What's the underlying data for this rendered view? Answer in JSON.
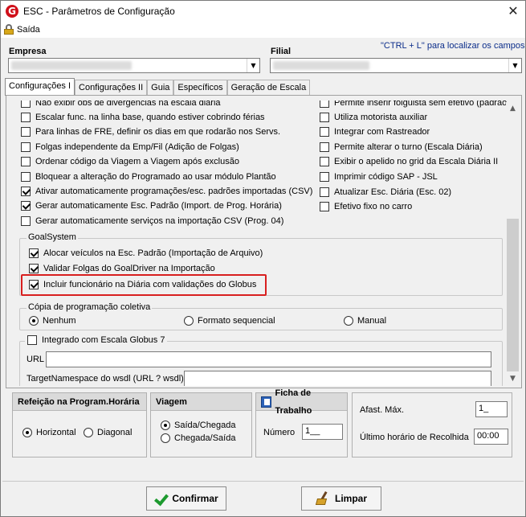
{
  "window": {
    "title": "ESC - Parâmetros de Configuração",
    "close_glyph": "✕",
    "app_icon_letter": "G"
  },
  "menu": {
    "sair": "Saída"
  },
  "empresa": {
    "label": "Empresa"
  },
  "filial": {
    "label": "Filial"
  },
  "hint": "\"CTRL + L\" para localizar os campos",
  "tabs": [
    {
      "label": "Configurações I",
      "active": true
    },
    {
      "label": "Configurações II"
    },
    {
      "label": "Guia"
    },
    {
      "label": "Específicos"
    },
    {
      "label": "Geração de Escala"
    }
  ],
  "left_checks": [
    {
      "label": "Não exibir obs de divergências na escala diária",
      "checked": false
    },
    {
      "label": "Escalar func. na linha base, quando estiver cobrindo férias",
      "checked": false
    },
    {
      "label": "Para linhas de FRE, definir os dias em que rodarão nos Servs.",
      "checked": false
    },
    {
      "label": "Folgas independente da Emp/Fil (Adição de Folgas)",
      "checked": false
    },
    {
      "label": "Ordenar código da Viagem a Viagem após exclusão",
      "checked": false
    },
    {
      "label": "Bloquear a alteração do Programado ao usar módulo Plantão",
      "checked": false
    },
    {
      "label": "Ativar automaticamente programações/esc. padrões importadas (CSV)",
      "checked": true
    },
    {
      "label": "Gerar automaticamente Esc. Padrão (Import. de Prog. Horária)",
      "checked": true
    },
    {
      "label": "Gerar automaticamente serviços na importação CSV (Prog. 04)",
      "checked": false
    }
  ],
  "right_checks": [
    {
      "label": "Permite inserir folguista sem efetivo (padrão)",
      "checked": false
    },
    {
      "label": "Utiliza motorista auxiliar",
      "checked": false
    },
    {
      "label": "Integrar com Rastreador",
      "checked": false
    },
    {
      "label": "Permite alterar o turno (Escala Diária)",
      "checked": false
    },
    {
      "label": "Exibir o apelido no grid da Escala Diária II",
      "checked": false
    },
    {
      "label": "Imprimir código SAP - JSL",
      "checked": false
    },
    {
      "label": "Atualizar Esc. Diária (Esc. 02)",
      "checked": false
    },
    {
      "label": "Efetivo fixo no carro",
      "checked": false
    }
  ],
  "goalsystem": {
    "title": "GoalSystem",
    "items": [
      {
        "label": "Alocar veículos na Esc. Padrão (Importação de Arquivo)",
        "checked": true
      },
      {
        "label": "Validar Folgas do GoalDriver na Importação",
        "checked": true
      },
      {
        "label": "Incluir funcionário na Diária com validações do Globus",
        "checked": true
      }
    ]
  },
  "copia": {
    "title": "Cópia de programação coletiva",
    "options": [
      {
        "label": "Nenhum",
        "selected": true
      },
      {
        "label": "Formato sequencial",
        "selected": false
      },
      {
        "label": "Manual",
        "selected": false
      }
    ]
  },
  "globus7": {
    "label": "Integrado com Escala Globus 7",
    "checked": false,
    "url_label": "URL",
    "url_value": "",
    "ns_label": "TargetNamespace do wsdl (URL ? wsdl)",
    "ns_value": ""
  },
  "refeicao": {
    "title": "Refeição na Program.Horária",
    "options": [
      {
        "label": "Horizontal",
        "selected": true
      },
      {
        "label": "Diagonal",
        "selected": false
      }
    ]
  },
  "viagem": {
    "title": "Viagem",
    "options": [
      {
        "label": "Saída/Chegada",
        "selected": true
      },
      {
        "label": "Chegada/Saída",
        "selected": false
      }
    ]
  },
  "ficha": {
    "title": "Ficha de Trabalho",
    "numero_label": "Número",
    "numero_value": "1__"
  },
  "afast": {
    "label": "Afast. Máx.",
    "value": "1_",
    "recolhida_label": "Último horário de Recolhida",
    "recolhida_value": "00:00"
  },
  "buttons": {
    "confirmar": "Confirmar",
    "limpar": "Limpar"
  },
  "colors": {
    "highlight": "#d81f1f",
    "hint_text": "#0b2d8a",
    "app_icon": "#d0101a"
  }
}
